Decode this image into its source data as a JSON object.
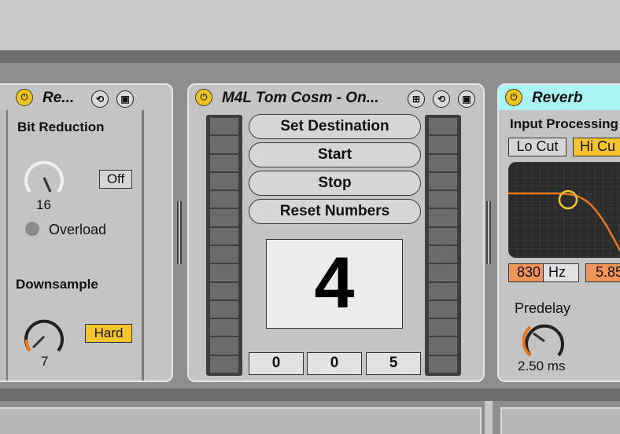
{
  "devices": {
    "left": {
      "title": "Re...",
      "bit_reduction": {
        "label": "Bit Reduction",
        "value": "16",
        "toggle": "Off",
        "overload_label": "Overload"
      },
      "downsample": {
        "label": "Downsample",
        "value": "7",
        "toggle": "Hard"
      }
    },
    "m4l": {
      "title": "M4L Tom Cosm - On...",
      "buttons": [
        "Set Destination",
        "Start",
        "Stop",
        "Reset Numbers"
      ],
      "display_value": "4",
      "numbers": [
        "0",
        "0",
        "5"
      ]
    },
    "reverb": {
      "title": "Reverb",
      "input_processing": "Input Processing",
      "lo_cut": "Lo Cut",
      "hi_cut": "Hi Cu",
      "freq_value": "830",
      "freq_unit": "Hz",
      "freq_value2": "5.85",
      "predelay_label": "Predelay",
      "predelay_value": "2.50 ms"
    }
  },
  "colors": {
    "power": "#f0c419",
    "toggle_on": "#f6c42c",
    "reverb_header": "#aaf4f6",
    "freq_fill": "#f3955a",
    "eq_curve": "#e8781f"
  },
  "icons": [
    "power-icon",
    "hot-swap-icon",
    "save-preset-icon",
    "map-icon"
  ]
}
